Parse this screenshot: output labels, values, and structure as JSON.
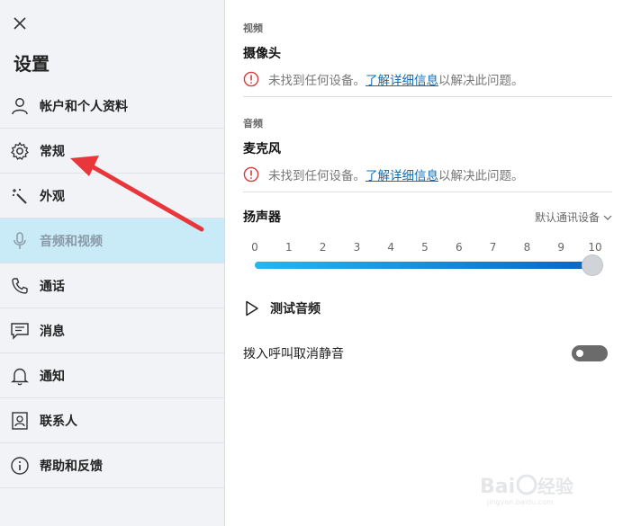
{
  "sidebar": {
    "title": "设置",
    "items": [
      {
        "label": "帐户和个人资料",
        "icon": "person-icon"
      },
      {
        "label": "常规",
        "icon": "gear-icon"
      },
      {
        "label": "外观",
        "icon": "magic-wand-icon"
      },
      {
        "label": "音频和视频",
        "icon": "microphone-icon",
        "active": true
      },
      {
        "label": "通话",
        "icon": "phone-icon"
      },
      {
        "label": "消息",
        "icon": "chat-icon"
      },
      {
        "label": "通知",
        "icon": "bell-icon"
      },
      {
        "label": "联系人",
        "icon": "contact-card-icon"
      },
      {
        "label": "帮助和反馈",
        "icon": "info-icon"
      }
    ]
  },
  "video": {
    "caption": "视频",
    "heading": "摄像头",
    "warning_text": "未找到任何设备。",
    "link_text": "了解详细信息",
    "warning_suffix": "以解决此问题。"
  },
  "audio": {
    "caption": "音频",
    "heading": "麦克风",
    "warning_text": "未找到任何设备。",
    "link_text": "了解详细信息",
    "warning_suffix": "以解决此问题。"
  },
  "speaker": {
    "heading": "扬声器",
    "device": "默认通讯设备",
    "ticks": [
      "0",
      "1",
      "2",
      "3",
      "4",
      "5",
      "6",
      "7",
      "8",
      "9",
      "10"
    ],
    "volume": 10,
    "volume_max": 10
  },
  "test_audio_label": "测试音频",
  "unmute_label": "拨入呼叫取消静音",
  "unmute_enabled": false,
  "watermark": {
    "text": "Baidu 经验",
    "subtext": "jingyan.baidu.com"
  },
  "colors": {
    "accent": "#0a64c4",
    "active_bg": "#c9ebf8",
    "warning": "#d73a3a",
    "annotation_arrow": "#e8363b"
  }
}
